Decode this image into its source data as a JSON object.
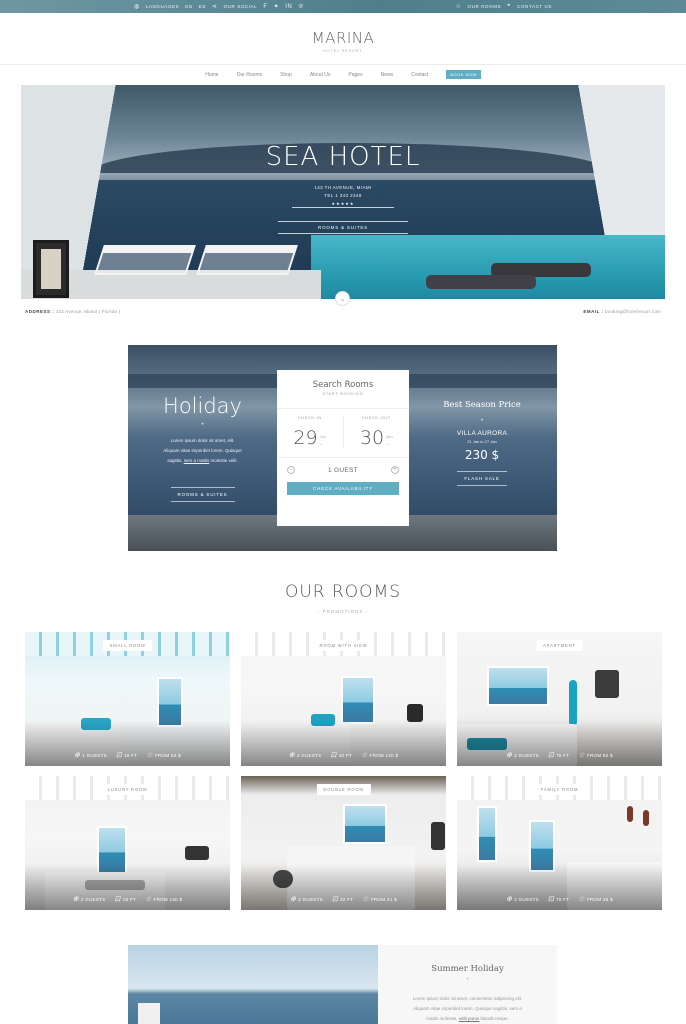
{
  "topbar": {
    "languages": "LANGUAGES",
    "lang_en": "EN",
    "lang_es": "ES",
    "social": "OUR SOCIAL",
    "our_rooms": "OUR ROOMS",
    "contact": "CONTACT US"
  },
  "logo": {
    "name": "MARINA",
    "subtitle": "HOTEL RESORT"
  },
  "nav": {
    "items": [
      "Home",
      "Our Rooms",
      "Shop",
      "About Us",
      "Pages",
      "News",
      "Contact"
    ],
    "book": "BOOK NOW"
  },
  "hero": {
    "title": "SEA HOTEL",
    "address": "143 TH AVENUE, MIAMI",
    "tel": "TEL 1 343 2348",
    "stars": "★★★★★",
    "button": "ROOMS & SUITES"
  },
  "info": {
    "address_label": "ADDRESS :",
    "address_value": "143 Avenue, Miami ( Florida )",
    "email_label": "EMAIL :",
    "email_value": "booking@hotelresort.com"
  },
  "booking": {
    "holiday": "Holiday",
    "holiday_dot": "•",
    "lorem_1": "Lorem ipsum dolor sit amet, elit.",
    "lorem_2": "Aliquam vitae imperdiet lorem. Quisque",
    "lorem_3a": "sagittis,",
    "lorem_3_link": "sem a mattis",
    "lorem_3b": "molestie velit.",
    "left_button": "ROOMS & SUITES",
    "best": "Best Season Price",
    "best_dot": "•",
    "villa": "VILLA AURORA",
    "villa_dates": "21 Jan to 27 Jan",
    "price": "230 $",
    "right_button": "FLASH SALE"
  },
  "search": {
    "title": "Search Rooms",
    "subtitle": "START BOOKING",
    "checkin_label": "CHECK-IN",
    "checkout_label": "CHECK-OUT",
    "checkin_day": "29",
    "checkin_month": "Jun",
    "checkout_day": "30",
    "checkout_month": "Jun",
    "chevron": "⌄",
    "minus": "−",
    "plus": "+",
    "guests": "1 GUEST",
    "button": "CHECK AVAILABILITY"
  },
  "rooms": {
    "title": "OUR ROOMS",
    "subtitle": "- PROMOTIONS -",
    "items": [
      {
        "tag": "SMALL ROOM",
        "guests": "1 GUESTS",
        "size": "15 FT",
        "price": "FROM 50 $"
      },
      {
        "tag": "ROOM WITH VIEW",
        "guests": "4 GUESTS",
        "size": "40 FT",
        "price": "FROM 120 $"
      },
      {
        "tag": "APARTMENT",
        "guests": "2 GUESTS",
        "size": "75 FT",
        "price": "FROM 80 $"
      },
      {
        "tag": "LUXURY ROOM",
        "guests": "2 GUESTS",
        "size": "18 FT",
        "price": "FROM 180 $"
      },
      {
        "tag": "DOUBLE ROOM",
        "guests": "2 GUESTS",
        "size": "22 FT",
        "price": "FROM 21 $"
      },
      {
        "tag": "FAMILY ROOM",
        "guests": "2 GUESTS",
        "size": "70 FT",
        "price": "FROM 35 $"
      }
    ]
  },
  "summer": {
    "title": "Summer Holiday",
    "dot": "•",
    "line1": "Lorem ipsum dolor sit amet, consectetur adipiscing elit.",
    "line2": "Aliquam vitae imperdiet lorem. Quisque sagittis, sem a",
    "line3a": "mattis molestie,",
    "line3_link": "velit purus",
    "line3b": "blandit neque."
  },
  "colors": {
    "accent": "#5faec2",
    "topbar": "#5a8794"
  }
}
